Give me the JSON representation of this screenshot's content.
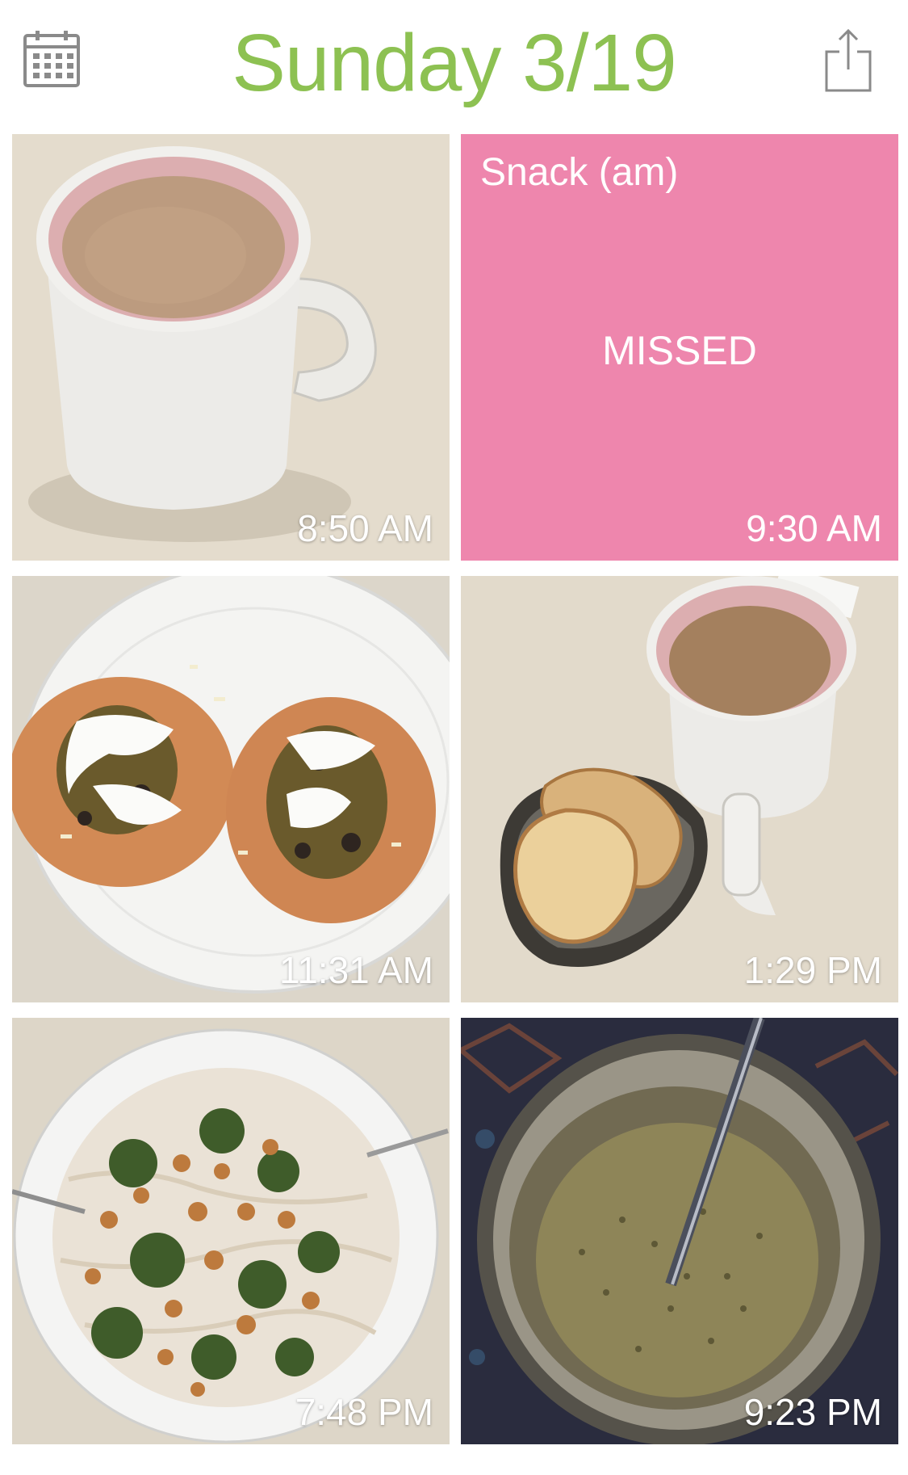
{
  "header": {
    "title": "Sunday 3/19",
    "title_color": "#8dc152",
    "left_icon": "calendar-icon",
    "right_icon": "share-icon"
  },
  "accent_colors": {
    "missed_tile": "#ee86ad",
    "icon_gray": "#8a8a8a"
  },
  "entries": [
    {
      "time": "8:50 AM",
      "photo": "mug-of-coffee"
    },
    {
      "time": "9:30 AM",
      "label": "Snack (am)",
      "status": "MISSED"
    },
    {
      "time": "11:31 AM",
      "photo": "tacos-on-plate"
    },
    {
      "time": "1:29 PM",
      "photo": "coffee-and-toast"
    },
    {
      "time": "7:48 PM",
      "photo": "noodles-chickpeas-broccoli"
    },
    {
      "time": "9:23 PM",
      "photo": "chia-pudding-jar"
    }
  ]
}
